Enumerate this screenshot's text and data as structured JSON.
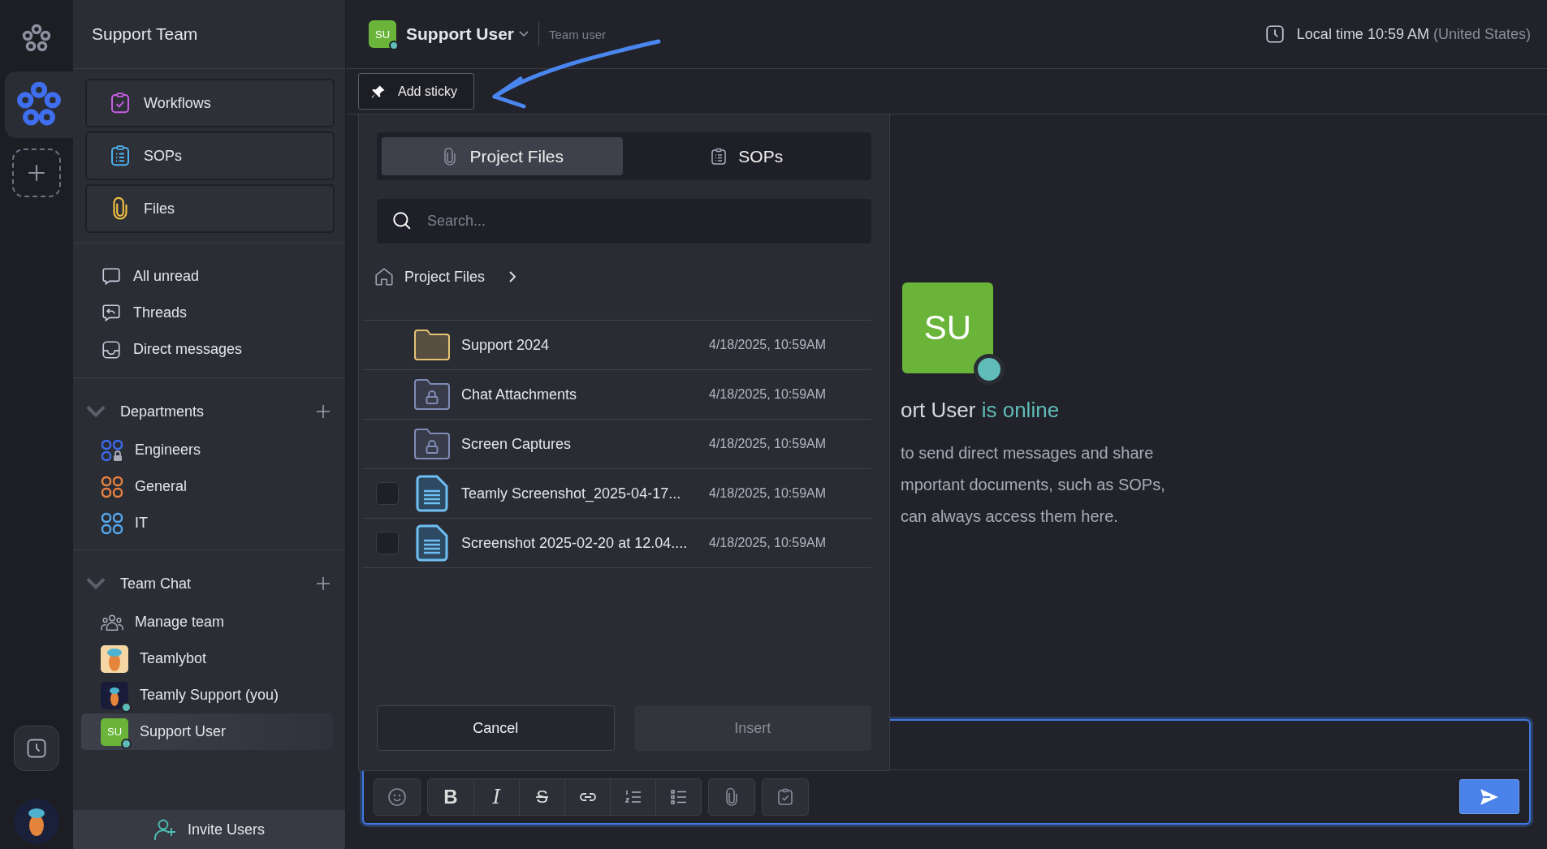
{
  "rail": {
    "workspaces": [
      {
        "selected": true
      }
    ]
  },
  "sidebar": {
    "title": "Support Team",
    "shortcuts": [
      {
        "label": "Workflows",
        "kind": "workflows"
      },
      {
        "label": "SOPs",
        "kind": "sops"
      },
      {
        "label": "Files",
        "kind": "files"
      }
    ],
    "views": [
      {
        "label": "All unread",
        "kind": "unread",
        "selected": false
      },
      {
        "label": "Threads",
        "kind": "threads",
        "selected": false
      },
      {
        "label": "Direct messages",
        "kind": "inbox",
        "selected": false
      }
    ],
    "sections": [
      {
        "title": "Departments",
        "expanded": true,
        "items": [
          {
            "label": "Engineers",
            "kind": "channel",
            "color": "#3d6bf0",
            "locked": true,
            "selected": false
          },
          {
            "label": "General",
            "kind": "channel",
            "color": "#e8823f",
            "locked": false,
            "selected": false
          },
          {
            "label": "IT",
            "kind": "channel",
            "color": "#56a9ee",
            "locked": false,
            "selected": false
          }
        ]
      },
      {
        "title": "Team Chat",
        "expanded": true,
        "items": [
          {
            "label": "Manage team",
            "kind": "team",
            "selected": false
          },
          {
            "label": "Teamlybot",
            "kind": "bot",
            "online": false,
            "selected": false
          },
          {
            "label": "Teamly Support (you)",
            "kind": "mascot",
            "online": true,
            "selected": false
          },
          {
            "label": "Support User",
            "kind": "initials",
            "initials": "SU",
            "online": true,
            "selected": true
          }
        ]
      }
    ],
    "invite": "Invite Users"
  },
  "header": {
    "initials": "SU",
    "online": true,
    "name": "Support User",
    "role": "Team user",
    "local_time": "Local time 10:59 AM",
    "region": "(United States)"
  },
  "toolbar": {
    "add_sticky": "Add sticky"
  },
  "dialog": {
    "tabs": [
      {
        "label": "Project Files",
        "kind": "files",
        "selected": true
      },
      {
        "label": "SOPs",
        "kind": "sops",
        "selected": false
      }
    ],
    "search": {
      "placeholder": "Search..."
    },
    "breadcrumb": "Project Files",
    "files": [
      {
        "name": "Support 2024",
        "date": "4/18/2025, 10:59AM",
        "kind": "folder"
      },
      {
        "name": "Chat Attachments",
        "date": "4/18/2025, 10:59AM",
        "kind": "locked_folder"
      },
      {
        "name": "Screen Captures",
        "date": "4/18/2025, 10:59AM",
        "kind": "locked_folder"
      },
      {
        "name": "Teamly Screenshot_2025-04-17...",
        "date": "4/18/2025, 10:59AM",
        "kind": "document",
        "checked": false
      },
      {
        "name": "Screenshot 2025-02-20 at 12.04....",
        "date": "4/18/2025, 10:59AM",
        "kind": "document",
        "checked": false
      }
    ],
    "cancel": "Cancel",
    "insert": {
      "label": "Insert",
      "disabled": true
    }
  },
  "profile": {
    "initials": "SU",
    "online": true,
    "name": "ort User",
    "status": "is online",
    "lines": [
      "to send direct messages and share",
      "mportant documents, such as SOPs,",
      "can always access them here."
    ]
  },
  "composer": {
    "tools": [
      {
        "kind": "emoji"
      },
      {
        "kind": "bold",
        "glyph": "B"
      },
      {
        "kind": "italic",
        "glyph": "I"
      },
      {
        "kind": "strike",
        "glyph": "S"
      },
      {
        "kind": "link"
      },
      {
        "kind": "ordered"
      },
      {
        "kind": "bullets"
      },
      {
        "kind": "attach"
      },
      {
        "kind": "task"
      }
    ]
  }
}
